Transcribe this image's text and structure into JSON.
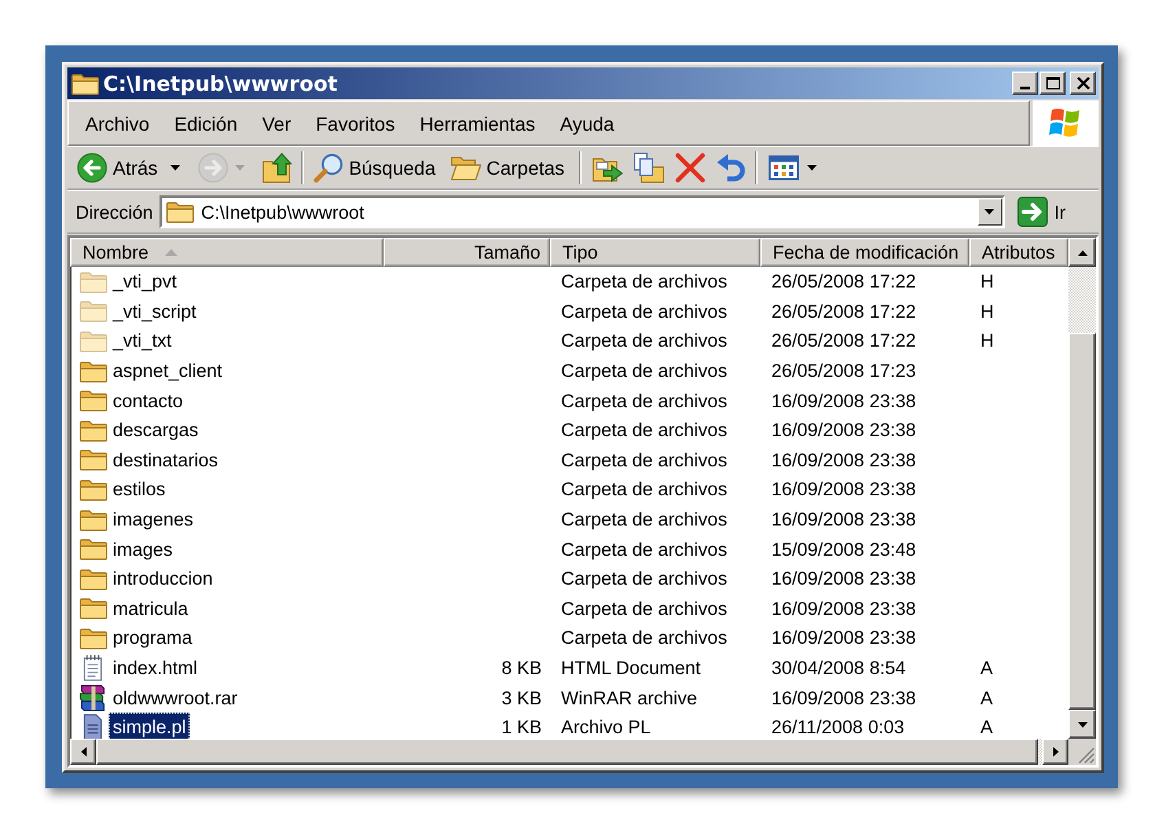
{
  "window": {
    "title": "C:\\Inetpub\\wwwroot"
  },
  "menu": [
    "Archivo",
    "Edición",
    "Ver",
    "Favoritos",
    "Herramientas",
    "Ayuda"
  ],
  "toolbar": {
    "groups": [
      [
        {
          "kind": "back",
          "label": "Atrás",
          "disabled": false
        },
        {
          "kind": "forward",
          "disabled": true
        },
        {
          "kind": "up",
          "disabled": false
        }
      ],
      [
        {
          "kind": "search",
          "label": "Búsqueda",
          "disabled": false
        },
        {
          "kind": "folders",
          "label": "Carpetas",
          "disabled": false
        }
      ],
      [
        {
          "kind": "move",
          "disabled": false
        },
        {
          "kind": "copy",
          "disabled": false
        },
        {
          "kind": "delete",
          "disabled": false
        },
        {
          "kind": "undo",
          "disabled": false
        }
      ],
      [
        {
          "kind": "views",
          "disabled": false
        }
      ]
    ]
  },
  "address_bar": {
    "label": "Dirección",
    "value": "C:\\Inetpub\\wwwroot",
    "go_button": "Ir"
  },
  "file_list": {
    "columns": [
      {
        "label": "Nombre",
        "sorted": true
      },
      {
        "label": "Tamaño",
        "sorted": false
      },
      {
        "label": "Tipo",
        "sorted": false
      },
      {
        "label": "Fecha de modificación",
        "sorted": false
      },
      {
        "label": "Atributos",
        "sorted": false
      }
    ],
    "rows": [
      {
        "kind": "folder",
        "name": "_vti_pvt",
        "type": "Carpeta de archivos",
        "modified": "26/05/2008 17:22",
        "attributes": "H",
        "hidden": true,
        "selected": false
      },
      {
        "kind": "folder",
        "name": "_vti_script",
        "type": "Carpeta de archivos",
        "modified": "26/05/2008 17:22",
        "attributes": "H",
        "hidden": true,
        "selected": false
      },
      {
        "kind": "folder",
        "name": "_vti_txt",
        "type": "Carpeta de archivos",
        "modified": "26/05/2008 17:22",
        "attributes": "H",
        "hidden": true,
        "selected": false
      },
      {
        "kind": "folder",
        "name": "aspnet_client",
        "type": "Carpeta de archivos",
        "modified": "26/05/2008 17:23",
        "hidden": false,
        "selected": false
      },
      {
        "kind": "folder",
        "name": "contacto",
        "type": "Carpeta de archivos",
        "modified": "16/09/2008 23:38",
        "hidden": false,
        "selected": false
      },
      {
        "kind": "folder",
        "name": "descargas",
        "type": "Carpeta de archivos",
        "modified": "16/09/2008 23:38",
        "hidden": false,
        "selected": false
      },
      {
        "kind": "folder",
        "name": "destinatarios",
        "type": "Carpeta de archivos",
        "modified": "16/09/2008 23:38",
        "hidden": false,
        "selected": false
      },
      {
        "kind": "folder",
        "name": "estilos",
        "type": "Carpeta de archivos",
        "modified": "16/09/2008 23:38",
        "hidden": false,
        "selected": false
      },
      {
        "kind": "folder",
        "name": "imagenes",
        "type": "Carpeta de archivos",
        "modified": "16/09/2008 23:38",
        "hidden": false,
        "selected": false
      },
      {
        "kind": "folder",
        "name": "images",
        "type": "Carpeta de archivos",
        "modified": "15/09/2008 23:48",
        "hidden": false,
        "selected": false
      },
      {
        "kind": "folder",
        "name": "introduccion",
        "type": "Carpeta de archivos",
        "modified": "16/09/2008 23:38",
        "hidden": false,
        "selected": false
      },
      {
        "kind": "folder",
        "name": "matricula",
        "type": "Carpeta de archivos",
        "modified": "16/09/2008 23:38",
        "hidden": false,
        "selected": false
      },
      {
        "kind": "folder",
        "name": "programa",
        "type": "Carpeta de archivos",
        "modified": "16/09/2008 23:38",
        "hidden": false,
        "selected": false
      },
      {
        "kind": "html",
        "name": "index.html",
        "size": "8 KB",
        "type": "HTML Document",
        "modified": "30/04/2008 8:54",
        "attributes": "A",
        "hidden": false,
        "selected": false
      },
      {
        "kind": "rar",
        "name": "oldwwwroot.rar",
        "size": "3 KB",
        "type": "WinRAR archive",
        "modified": "16/09/2008 23:38",
        "attributes": "A",
        "hidden": false,
        "selected": false
      },
      {
        "kind": "file",
        "name": "simple.pl",
        "size": "1 KB",
        "type": "Archivo PL",
        "modified": "26/11/2008 0:03",
        "attributes": "A",
        "hidden": false,
        "selected": true
      }
    ]
  }
}
